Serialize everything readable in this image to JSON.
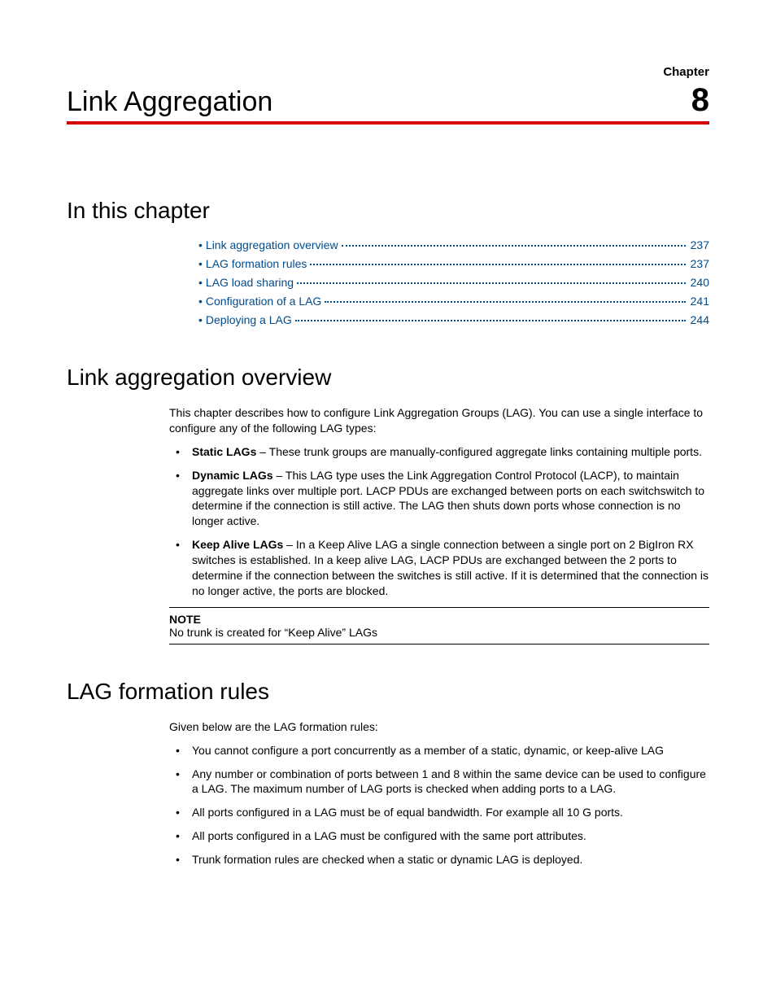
{
  "header": {
    "chapter_label": "Chapter",
    "title": "Link Aggregation",
    "number": "8"
  },
  "sections": {
    "in_this_chapter": "In this chapter",
    "overview": "Link aggregation overview",
    "rules": "LAG formation rules"
  },
  "toc": [
    {
      "label": "Link aggregation overview",
      "page": "237"
    },
    {
      "label": "LAG formation rules",
      "page": "237"
    },
    {
      "label": "LAG load sharing",
      "page": "240"
    },
    {
      "label": "Configuration of a LAG",
      "page": "241"
    },
    {
      "label": "Deploying a LAG",
      "page": "244"
    }
  ],
  "overview": {
    "intro": "This chapter describes how to configure Link Aggregation Groups (LAG). You can use a single interface to configure any of the following LAG types:",
    "items": [
      {
        "bold": "Static LAGs",
        "rest": " – These trunk groups are manually-configured aggregate links containing multiple ports."
      },
      {
        "bold": "Dynamic LAGs",
        "rest": " – This LAG type uses the Link Aggregation Control Protocol (LACP), to maintain aggregate links over multiple port. LACP PDUs are exchanged between ports on each switchswitch to determine if the connection is still active. The LAG then shuts down ports whose connection is no longer active."
      },
      {
        "bold": "Keep Alive LAGs",
        "rest": " – In a Keep Alive LAG a single connection between a single port on 2 BigIron RX switches is established. In a keep alive LAG, LACP PDUs are exchanged between the 2 ports to determine if the connection between the switches is still active. If it is determined that the connection is no longer active, the ports are blocked."
      }
    ],
    "note_label": "NOTE",
    "note_text": "No trunk is created for “Keep Alive” LAGs"
  },
  "rules": {
    "intro": "Given below are the LAG formation rules:",
    "items": [
      "You cannot configure a port concurrently as a member of a static, dynamic, or keep-alive LAG",
      "Any number or combination of ports between 1 and 8 within the same device can be used to configure a LAG. The maximum number of LAG ports is checked when adding ports to a LAG.",
      "All ports configured in a LAG must be of equal bandwidth. For example all 10 G ports.",
      "All ports configured in a LAG must be configured with the same port attributes.",
      "Trunk formation rules are checked when a static or dynamic LAG is deployed."
    ]
  }
}
